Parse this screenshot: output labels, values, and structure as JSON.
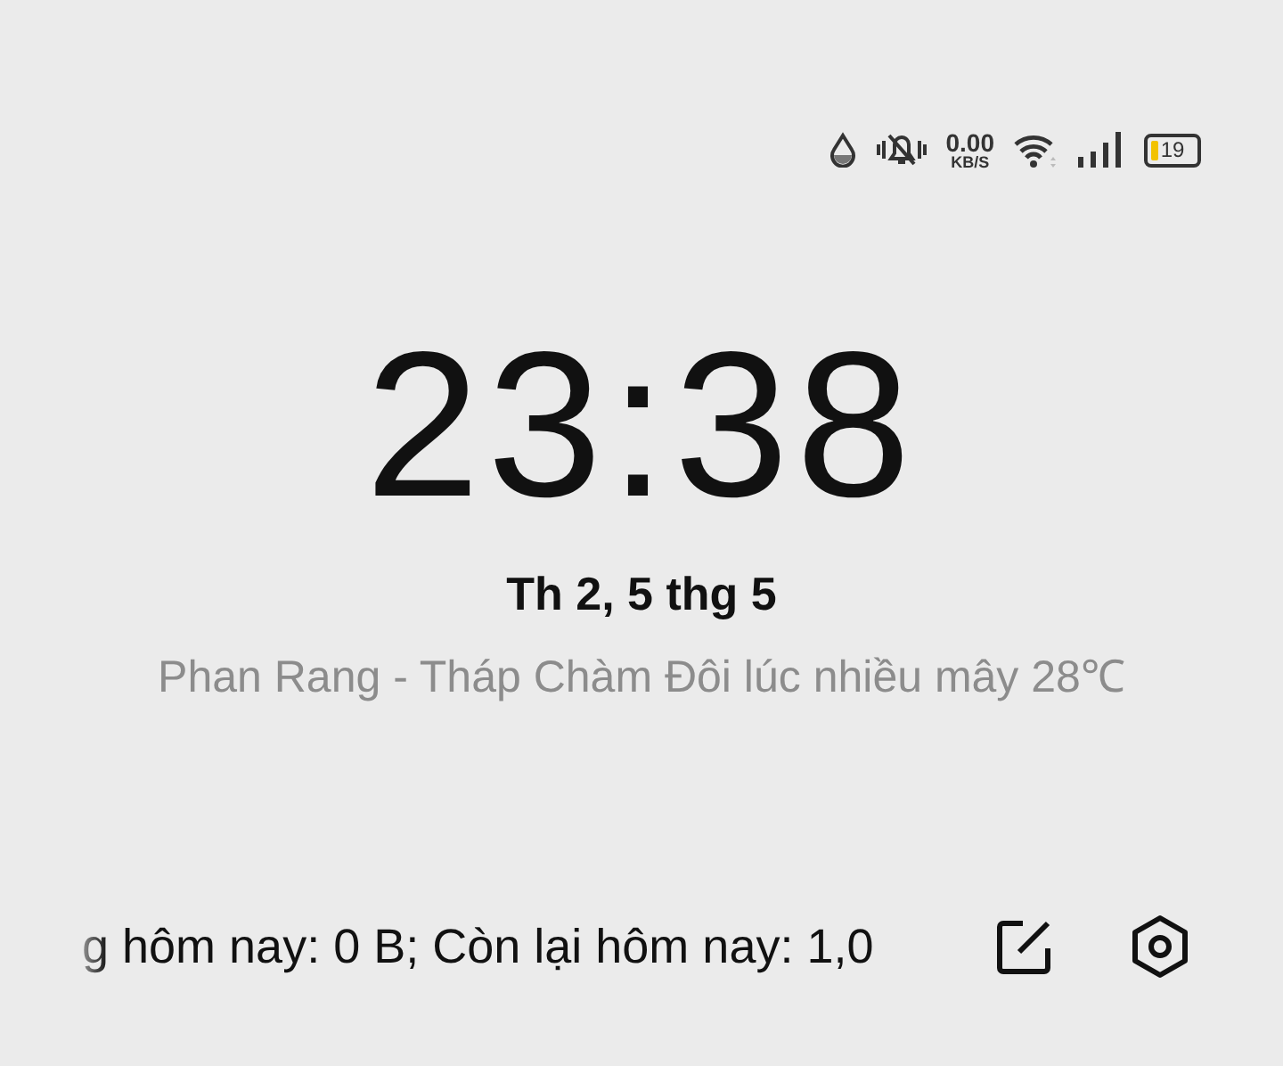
{
  "status_bar": {
    "speed_value": "0.00",
    "speed_unit": "KB/S",
    "battery": "19"
  },
  "clock": {
    "time": "23:38",
    "date": "Th 2, 5 thg 5",
    "weather": "Phan Rang - Tháp Chàm Đôi lúc nhiều mây 28℃"
  },
  "bottom_bar": {
    "data_usage": "g hôm nay: 0 B; Còn lại hôm nay: 1,0"
  }
}
